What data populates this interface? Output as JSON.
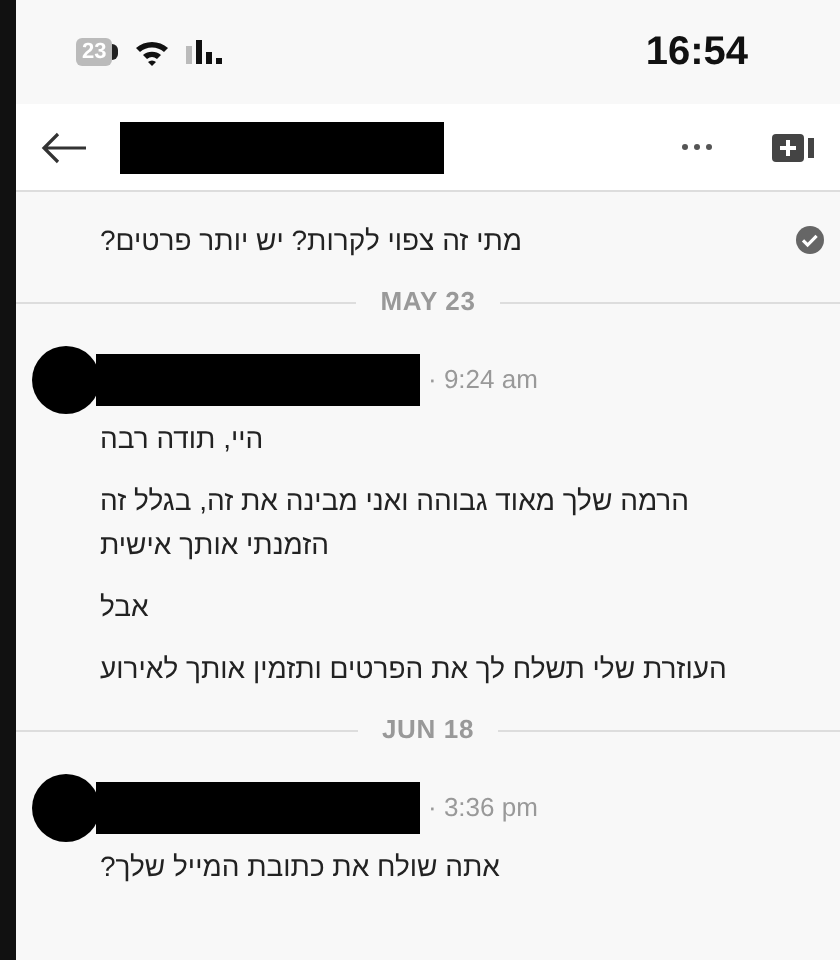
{
  "status_bar": {
    "battery": "23",
    "time": "16:54"
  },
  "messages": [
    {
      "kind": "continuation",
      "paragraphs": [
        "מתי זה צפוי לקרות? יש יותר פרטים?"
      ],
      "read": true
    },
    {
      "kind": "divider",
      "label": "MAY 23"
    },
    {
      "kind": "message",
      "time": "· 9:24 am",
      "paragraphs": [
        "היי, תודה רבה",
        "הרמה שלך מאוד גבוהה ואני מבינה את זה, בגלל זה הזמנתי אותך אישית",
        "אבל",
        "העוזרת שלי תשלח לך את הפרטים ותזמין אותך לאירוע"
      ]
    },
    {
      "kind": "divider",
      "label": "JUN 18"
    },
    {
      "kind": "message",
      "time": "· 3:36 pm",
      "paragraphs": [
        "אתה שולח את כתובת המייל שלך?"
      ]
    }
  ]
}
